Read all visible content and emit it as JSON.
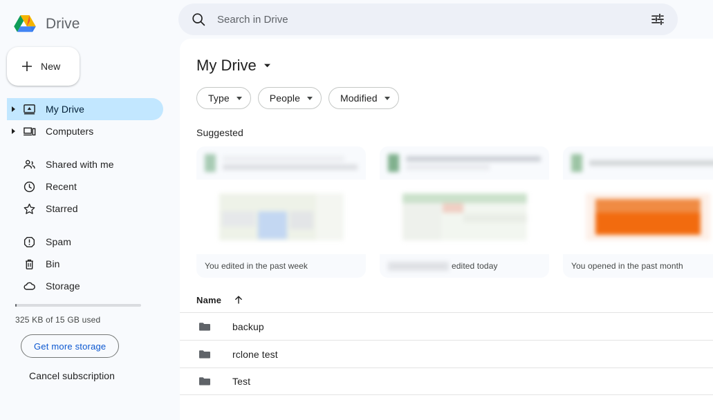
{
  "brand": {
    "title": "Drive",
    "logo_icon": "drive-logo-icon"
  },
  "sidebar": {
    "new_button": {
      "label": "New",
      "icon": "plus-icon"
    },
    "items": [
      {
        "label": "My Drive",
        "icon": "my-drive-icon",
        "name": "sidebar-item-my-drive",
        "active": true,
        "expandable": true
      },
      {
        "label": "Computers",
        "icon": "computers-icon",
        "name": "sidebar-item-computers",
        "active": false,
        "expandable": true
      },
      {
        "label": "Shared with me",
        "icon": "people-icon",
        "name": "sidebar-item-shared-with-me",
        "active": false,
        "expandable": false
      },
      {
        "label": "Recent",
        "icon": "clock-icon",
        "name": "sidebar-item-recent",
        "active": false,
        "expandable": false
      },
      {
        "label": "Starred",
        "icon": "star-icon",
        "name": "sidebar-item-starred",
        "active": false,
        "expandable": false
      },
      {
        "label": "Spam",
        "icon": "spam-icon",
        "name": "sidebar-item-spam",
        "active": false,
        "expandable": false
      },
      {
        "label": "Bin",
        "icon": "trash-icon",
        "name": "sidebar-item-bin",
        "active": false,
        "expandable": false
      },
      {
        "label": "Storage",
        "icon": "cloud-icon",
        "name": "sidebar-item-storage",
        "active": false,
        "expandable": false
      }
    ],
    "storage": {
      "usage_text": "325 KB of 15 GB used",
      "used": "325 KB",
      "total": "15 GB",
      "percent_used": 0,
      "get_more_label": "Get more storage",
      "cancel_label": "Cancel subscription"
    }
  },
  "search": {
    "placeholder": "Search in Drive",
    "value": "",
    "icon": "search-icon",
    "tune_icon": "tune-icon"
  },
  "main": {
    "page_title": "My Drive",
    "title_caret_icon": "caret-down-icon",
    "chips": [
      {
        "label": "Type",
        "name": "filter-chip-type"
      },
      {
        "label": "People",
        "name": "filter-chip-people"
      },
      {
        "label": "Modified",
        "name": "filter-chip-modified"
      }
    ],
    "suggested": {
      "section_title": "Suggested",
      "cards": [
        {
          "footer_text": "You edited in the past week",
          "has_blurred_prefix": false,
          "accent_color": "#a8cbb4",
          "thumb_color": "#eef2e8"
        },
        {
          "footer_text": "edited today",
          "has_blurred_prefix": true,
          "accent_color": "#7fb08d",
          "thumb_color": "#cfe3cf"
        },
        {
          "footer_text": "You opened in the past month",
          "has_blurred_prefix": false,
          "accent_color": "#9cc4a4",
          "thumb_color": "#f26b0f"
        }
      ]
    },
    "file_list": {
      "columns": [
        "Name"
      ],
      "sort_icon": "arrow-up-icon",
      "rows": [
        {
          "name": "backup",
          "icon": "folder-icon"
        },
        {
          "name": "rclone test",
          "icon": "folder-icon"
        },
        {
          "name": "Test",
          "icon": "folder-icon"
        }
      ]
    }
  },
  "colors": {
    "page_bg": "#f8fafd",
    "content_bg": "#ffffff",
    "active_pill": "#c2e7ff",
    "link_blue": "#0b57d0",
    "text_primary": "#1f1f1f",
    "text_secondary": "#444746",
    "folder_gray": "#5f6368",
    "search_bg": "#edf0f7"
  }
}
